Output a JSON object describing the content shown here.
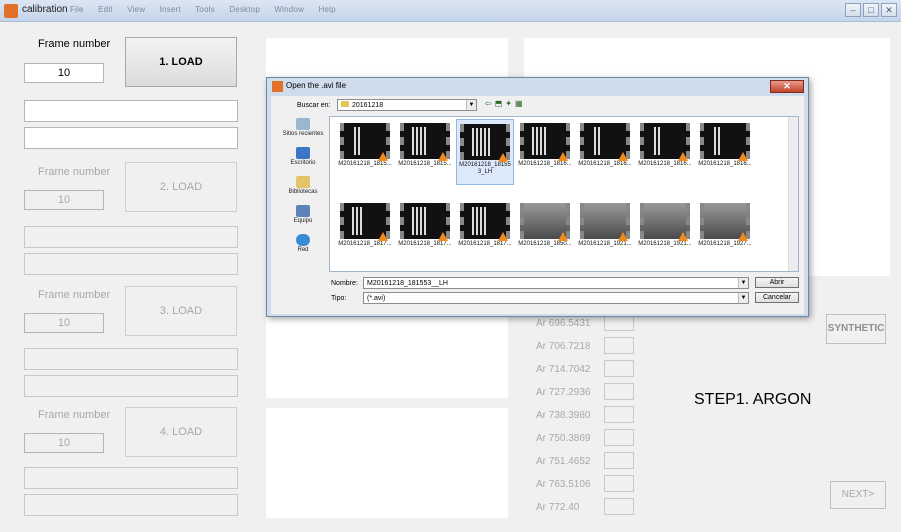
{
  "window": {
    "title": "calibration",
    "menu": [
      "File",
      "Edit",
      "View",
      "Insert",
      "Tools",
      "Desktop",
      "Window",
      "Help"
    ],
    "min": "–",
    "max": "□",
    "close": "✕"
  },
  "groups": [
    {
      "frame_label": "Frame number",
      "frame_value": "10",
      "load_label": "1. LOAD"
    },
    {
      "frame_label": "Frame number",
      "frame_value": "10",
      "load_label": "2. LOAD"
    },
    {
      "frame_label": "Frame number",
      "frame_value": "10",
      "load_label": "3. LOAD"
    },
    {
      "frame_label": "Frame number",
      "frame_value": "10",
      "load_label": "4. LOAD"
    }
  ],
  "argon_lines": [
    "Ar 696.5431",
    "Ar 706.7218",
    "Ar 714.7042",
    "Ar 727.2936",
    "Ar 738.3980",
    "Ar 750.3869",
    "Ar 751.4652",
    "Ar 763.5106",
    "Ar 772.40"
  ],
  "synthetic_label": "SYNTHETIC",
  "step_label": "STEP1. ARGON",
  "next_label": "NEXT>",
  "dialog": {
    "title": "Open the .avi file",
    "look_in_label": "Buscar en:",
    "look_in_value": "20161218",
    "places": [
      "Sitios recientes",
      "Escritorio",
      "Bibliotecas",
      "Equipo",
      "Red"
    ],
    "files": [
      "M20161218_1815...",
      "M20161218_1815...",
      "M20161218_181553_LH",
      "M20161218_1816...",
      "M20161218_1816...",
      "M20161218_1816...",
      "M20161218_1816...",
      "M20161218_1817...",
      "M20161218_1817...",
      "M20161218_1817...",
      "M20161218_1850...",
      "M20161218_1921...",
      "M20161218_1921...",
      "M20161218_1927..."
    ],
    "selected_index": 2,
    "name_label": "Nombre:",
    "name_value": "M20161218_181553__LH",
    "type_label": "Tipo:",
    "type_value": "(*.avi)",
    "open_label": "Abrir",
    "cancel_label": "Cancelar"
  }
}
